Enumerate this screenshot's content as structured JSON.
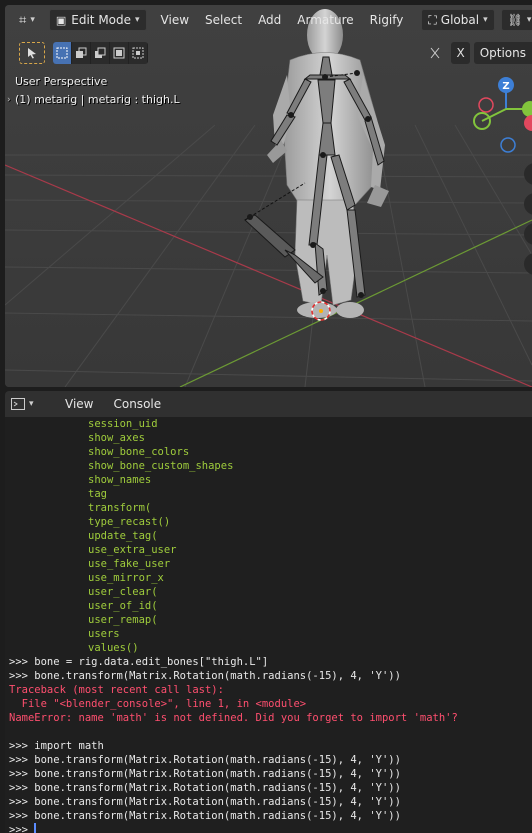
{
  "viewport": {
    "header": {
      "mode": "Edit Mode",
      "menus": [
        "View",
        "Select",
        "Add",
        "Armature",
        "Rigify"
      ],
      "orientation": "Global",
      "options": "Options",
      "x_label": "X"
    },
    "info": {
      "perspective": "User Perspective",
      "object": "(1) metarig | metarig : thigh.L"
    },
    "gizmo": {
      "z_label": "Z",
      "colors": {
        "x": "#e2485e",
        "y": "#82c43c",
        "z": "#3d7fd6"
      }
    }
  },
  "console": {
    "menus": [
      "View",
      "Console"
    ],
    "completion_list": [
      "session_uid",
      "show_axes",
      "show_bone_colors",
      "show_bone_custom_shapes",
      "show_names",
      "tag",
      "transform(",
      "type_recast()",
      "update_tag(",
      "use_extra_user",
      "use_fake_user",
      "use_mirror_x",
      "user_clear(",
      "user_of_id(",
      "user_remap(",
      "users",
      "values()"
    ],
    "history": [
      {
        "type": "input",
        "text": ">>> bone = rig.data.edit_bones[\"thigh.L\"]"
      },
      {
        "type": "input",
        "text": ">>> bone.transform(Matrix.Rotation(math.radians(-15), 4, 'Y'))"
      },
      {
        "type": "error",
        "text": "Traceback (most recent call last):"
      },
      {
        "type": "error",
        "text": "  File \"<blender_console>\", line 1, in <module>"
      },
      {
        "type": "error",
        "text": "NameError: name 'math' is not defined. Did you forget to import 'math'?"
      },
      {
        "type": "blank",
        "text": ""
      },
      {
        "type": "input",
        "text": ">>> import math"
      },
      {
        "type": "input",
        "text": ">>> bone.transform(Matrix.Rotation(math.radians(-15), 4, 'Y'))"
      },
      {
        "type": "input",
        "text": ">>> bone.transform(Matrix.Rotation(math.radians(-15), 4, 'Y'))"
      },
      {
        "type": "input",
        "text": ">>> bone.transform(Matrix.Rotation(math.radians(-15), 4, 'Y'))"
      },
      {
        "type": "input",
        "text": ">>> bone.transform(Matrix.Rotation(math.radians(-15), 4, 'Y'))"
      },
      {
        "type": "input",
        "text": ">>> bone.transform(Matrix.Rotation(math.radians(-15), 4, 'Y'))"
      }
    ],
    "prompt": ">>> ",
    "colors": {
      "completion": "#9fcc3c",
      "input": "#e8e8e8",
      "error": "#ff4f6f"
    }
  }
}
